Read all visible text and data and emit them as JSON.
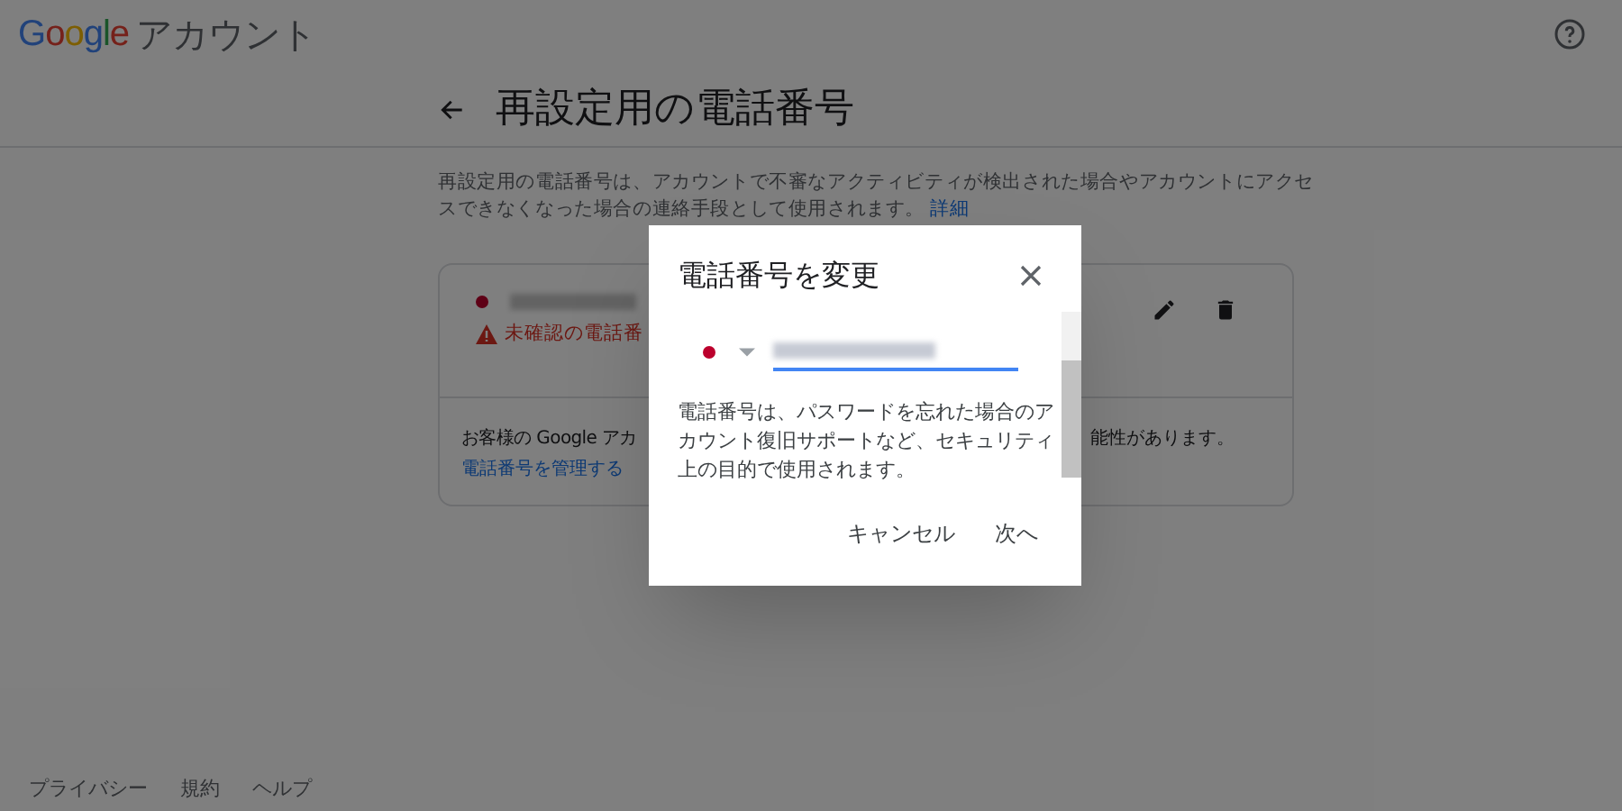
{
  "header": {
    "logo": "Google",
    "product": "アカウント"
  },
  "page": {
    "title": "再設定用の電話番号",
    "description": "再設定用の電話番号は、アカウントで不審なアクティビティが検出された場合やアカウントにアクセスできなくなった場合の連絡手段として使用されます。",
    "description_link": "詳細"
  },
  "card": {
    "warning": "未確認の電話番",
    "note_left": "お客様の Google アカ",
    "note_right": "能性があります。",
    "note_link": "電話番号を管理する"
  },
  "dialog": {
    "title": "電話番号を変更",
    "description": "電話番号は、パスワードを忘れた場合のアカウント復旧サポートなど、セキュリティ上の目的で使用されます。",
    "buttons": [
      "キャンセル",
      "次へ"
    ]
  },
  "footer": [
    "プライバシー",
    "規約",
    "ヘルプ"
  ]
}
